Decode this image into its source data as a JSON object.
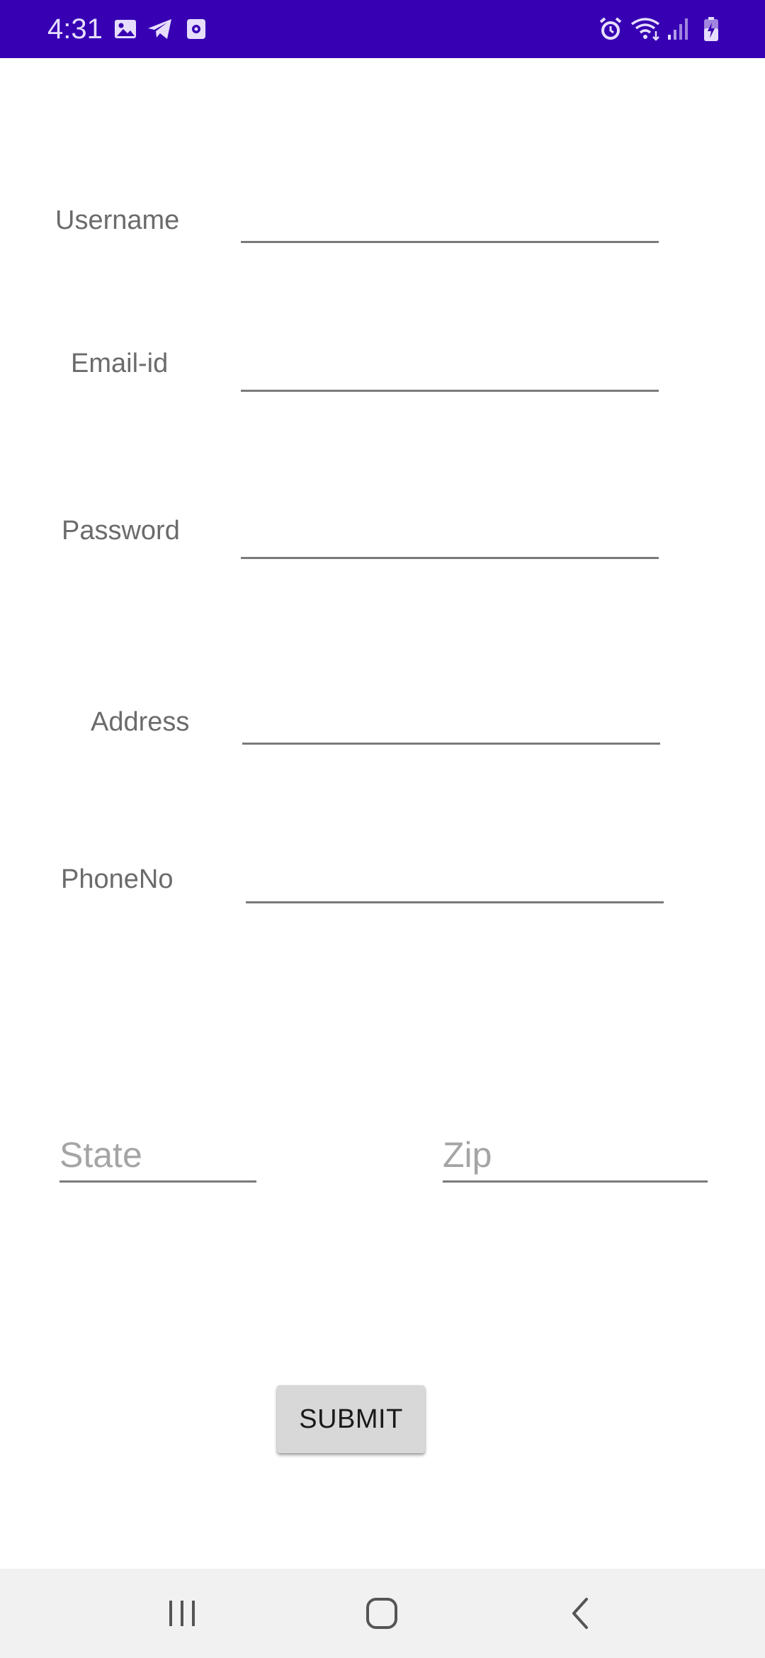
{
  "status_bar": {
    "time": "4:31",
    "background_color": "#3700b3",
    "left_icons": [
      "image-icon",
      "telegram-icon",
      "screen-record-icon"
    ],
    "right_icons": [
      "alarm-icon",
      "wifi-icon",
      "signal-icon",
      "battery-charging-icon"
    ]
  },
  "form": {
    "username_label": "Username",
    "email_label": "Email-id",
    "password_label": "Password",
    "address_label": "Address",
    "phone_label": "PhoneNo",
    "state_placeholder": "State",
    "zip_placeholder": "Zip"
  },
  "submit_label": "SUBMIT",
  "nav_bar": {
    "icons": [
      "recent-apps-icon",
      "home-icon",
      "back-icon"
    ]
  }
}
